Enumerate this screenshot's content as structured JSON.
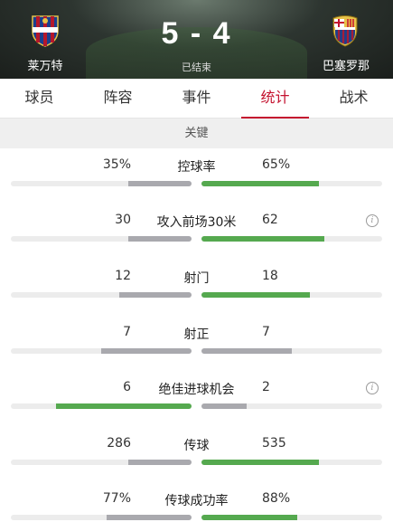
{
  "match": {
    "home_team": "莱万特",
    "away_team": "巴塞罗那",
    "score": "5 - 4",
    "status": "已结束"
  },
  "tabs": [
    "球员",
    "阵容",
    "事件",
    "统计",
    "战术"
  ],
  "active_tab": "统计",
  "section_title": "关键",
  "colors": {
    "accent": "#c4122f",
    "leading_bar": "#55a94f",
    "trailing_bar": "#a9a9ae",
    "track": "#ececec"
  },
  "stats": [
    {
      "name": "控球率",
      "home": "35%",
      "away": "65%",
      "home_share": 0.35,
      "away_share": 0.65,
      "leader": "away",
      "info": false
    },
    {
      "name": "攻入前场30米",
      "home": "30",
      "away": "62",
      "home_share": 0.35,
      "away_share": 0.68,
      "leader": "away",
      "info": true
    },
    {
      "name": "射门",
      "home": "12",
      "away": "18",
      "home_share": 0.4,
      "away_share": 0.6,
      "leader": "away",
      "info": false
    },
    {
      "name": "射正",
      "home": "7",
      "away": "7",
      "home_share": 0.5,
      "away_share": 0.5,
      "leader": "none",
      "info": false
    },
    {
      "name": "绝佳进球机会",
      "home": "6",
      "away": "2",
      "home_share": 0.75,
      "away_share": 0.25,
      "leader": "home",
      "info": true
    },
    {
      "name": "传球",
      "home": "286",
      "away": "535",
      "home_share": 0.35,
      "away_share": 0.65,
      "leader": "away",
      "info": false
    },
    {
      "name": "传球成功率",
      "home": "77%",
      "away": "88%",
      "home_share": 0.47,
      "away_share": 0.53,
      "leader": "away",
      "info": false
    }
  ]
}
